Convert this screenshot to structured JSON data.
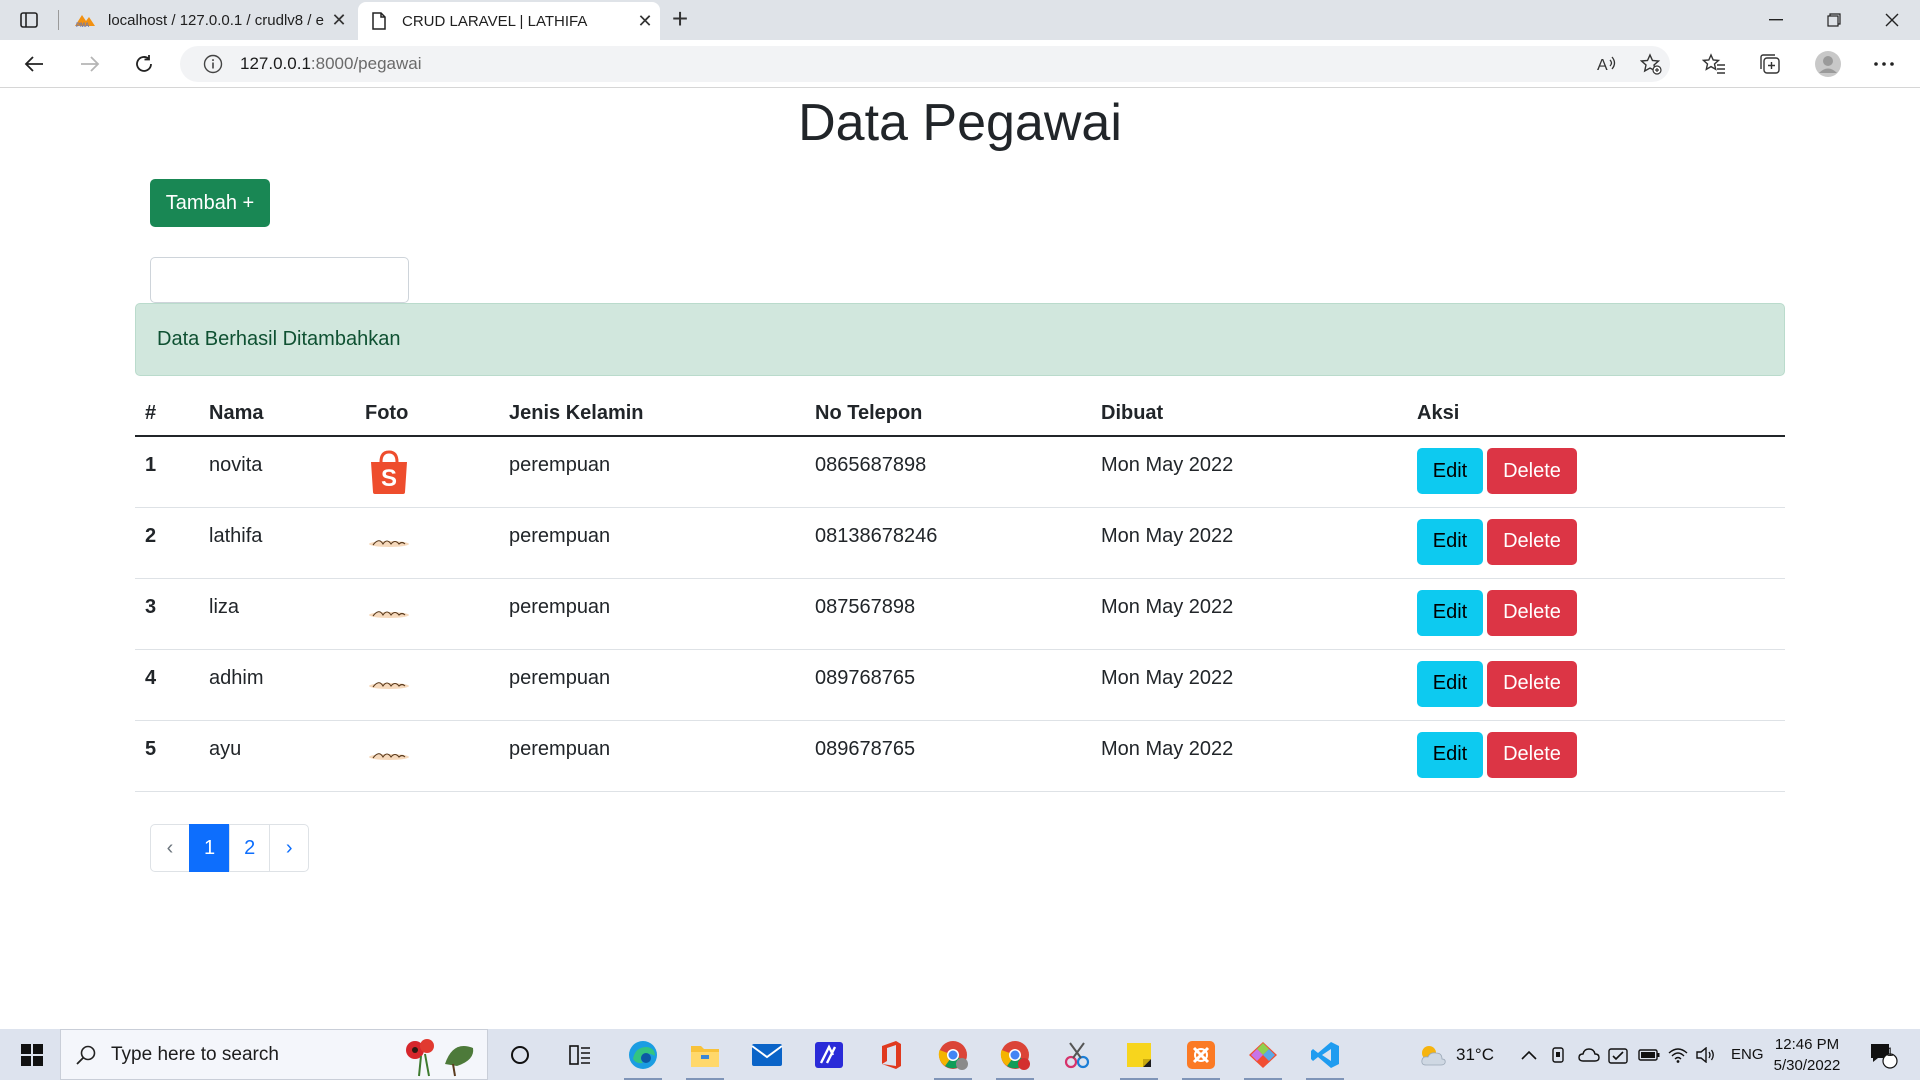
{
  "browser": {
    "tabs": [
      {
        "title": "localhost / 127.0.0.1 / crudlv8 / e",
        "favicon": "phpmyadmin-icon",
        "active": false
      },
      {
        "title": "CRUD LARAVEL | LATHIFA",
        "favicon": "page-icon",
        "active": true
      }
    ],
    "url_host": "127.0.0.1",
    "url_path": ":8000/pegawai"
  },
  "page": {
    "title": "Data Pegawai",
    "add_button": "Tambah +",
    "search_value": "",
    "alert": "Data Berhasil Ditambahkan",
    "table": {
      "headers": [
        "#",
        "Nama",
        "Foto",
        "Jenis Kelamin",
        "No Telepon",
        "Dibuat",
        "Aksi"
      ],
      "rows": [
        {
          "no": "1",
          "nama": "novita",
          "foto": "shopping-bag-image",
          "jk": "perempuan",
          "telepon": "0865687898",
          "dibuat": "Mon May 2022"
        },
        {
          "no": "2",
          "nama": "lathifa",
          "foto": "signature-image",
          "jk": "perempuan",
          "telepon": "08138678246",
          "dibuat": "Mon May 2022"
        },
        {
          "no": "3",
          "nama": "liza",
          "foto": "signature-image",
          "jk": "perempuan",
          "telepon": "087567898",
          "dibuat": "Mon May 2022"
        },
        {
          "no": "4",
          "nama": "adhim",
          "foto": "signature-image",
          "jk": "perempuan",
          "telepon": "089768765",
          "dibuat": "Mon May 2022"
        },
        {
          "no": "5",
          "nama": "ayu",
          "foto": "signature-image",
          "jk": "perempuan",
          "telepon": "089678765",
          "dibuat": "Mon May 2022"
        }
      ],
      "edit_label": "Edit",
      "delete_label": "Delete"
    },
    "pagination": {
      "prev": "‹",
      "pages": [
        "1",
        "2"
      ],
      "active": "1",
      "next": "›"
    }
  },
  "taskbar": {
    "search_placeholder": "Type here to search",
    "weather": "31°C",
    "language": "ENG",
    "time": "12:46 PM",
    "date": "5/30/2022",
    "notification_count": "1"
  },
  "colors": {
    "success": "#198754",
    "info": "#0dcaf0",
    "danger": "#dc3545",
    "primary": "#0d6efd",
    "alert_bg": "#d1e7dd"
  }
}
